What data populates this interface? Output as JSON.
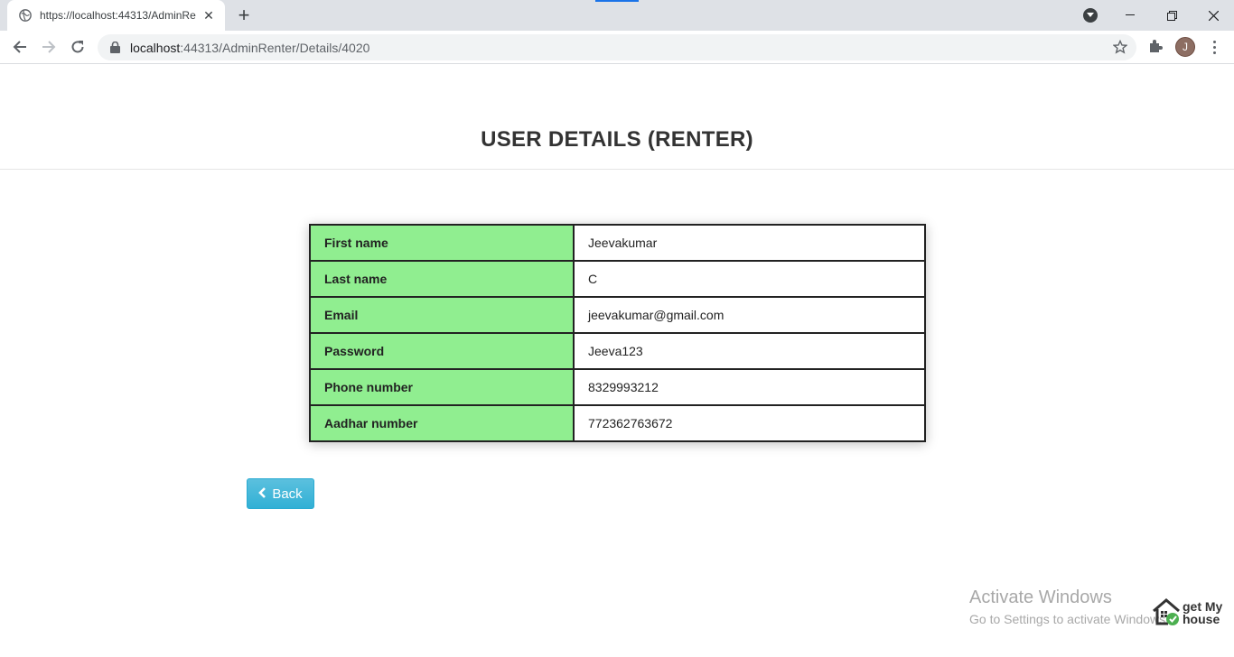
{
  "browser": {
    "tab_title": "https://localhost:44313/AdminRe",
    "url_host": "localhost",
    "url_rest": ":44313/AdminRenter/Details/4020",
    "profile_initial": "J"
  },
  "page": {
    "title": "USER DETAILS (RENTER)",
    "rows": [
      {
        "label": "First name",
        "value": "Jeevakumar"
      },
      {
        "label": "Last name",
        "value": "C"
      },
      {
        "label": "Email",
        "value": "jeevakumar@gmail.com"
      },
      {
        "label": "Password",
        "value": "Jeeva123"
      },
      {
        "label": "Phone number",
        "value": "8329993212"
      },
      {
        "label": "Aadhar number",
        "value": "772362763672"
      }
    ],
    "back_label": "Back"
  },
  "watermark": {
    "title": "Activate Windows",
    "subtitle": "Go to Settings to activate Windows."
  },
  "brand": {
    "line1": "get My",
    "line2": "house"
  },
  "colors": {
    "label_bg": "#90ee90",
    "button": "#31b0d5"
  }
}
